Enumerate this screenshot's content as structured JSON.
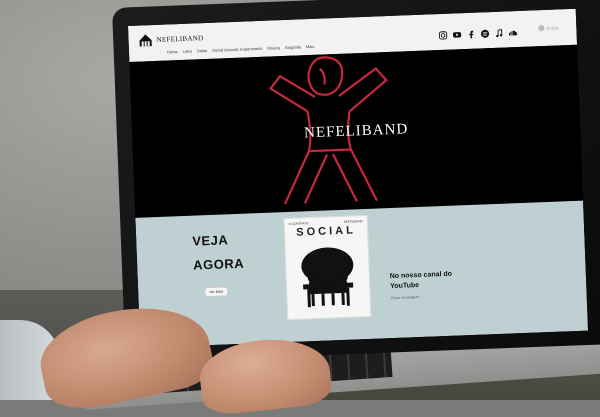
{
  "colors": {
    "hero_bg": "#000000",
    "accent_red": "#c8283c",
    "strip_bg": "#bfd0d3",
    "header_bg": "#f2f2f2"
  },
  "header": {
    "logo_text": "NEFELIBAND",
    "logo_icon": "house-icon",
    "nav": [
      "Home",
      "Letra",
      "Datas",
      "Social Acoustic Experiments",
      "Música",
      "Biografia",
      "Mais"
    ],
    "social_icons": [
      "instagram-icon",
      "youtube-icon",
      "facebook-icon",
      "spotify-icon",
      "music-note-icon",
      "soundcloud-icon"
    ],
    "login_label": "Entrar"
  },
  "hero": {
    "title": "NEFELIBAND"
  },
  "promo": {
    "line1": "VEJA",
    "line2": "AGORA",
    "button_label": "Ver Mais",
    "album_top_left": "O CONTRATO",
    "album_top_right": "NEFELIBAND",
    "album_word": "SOCIAL",
    "youtube_title": "No nosso canal do YouTube",
    "youtube_sub": "Clique na imagem"
  }
}
